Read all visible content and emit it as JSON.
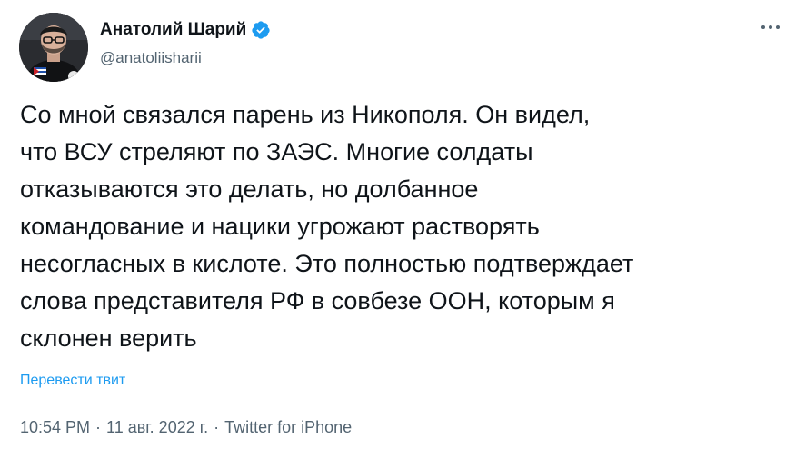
{
  "author": {
    "display_name": "Анатолий Шарий",
    "handle": "@anatoliisharii",
    "verified": true
  },
  "more_button": {
    "icon": "more-horizontal-icon"
  },
  "tweet": {
    "lines": [
      "Со мной связался парень из Никополя. Он видел,",
      "что ВСУ стреляют по ЗАЭС. Многие солдаты",
      "отказываются это делать, но долбанное",
      "командование и нацики угрожают растворять",
      "несогласных в кислоте. Это полностью подтверждает",
      "слова представителя РФ в совбезе ООН, которым я",
      "склонен верить"
    ],
    "translate_label": "Перевести твит"
  },
  "meta": {
    "time": "10:54 PM",
    "separator": "·",
    "date": "11 авг. 2022 г.",
    "source": "Twitter for iPhone"
  },
  "colors": {
    "text": "#0f1419",
    "secondary": "#536471",
    "link": "#1d9bf0",
    "verified": "#1d9bf0"
  }
}
